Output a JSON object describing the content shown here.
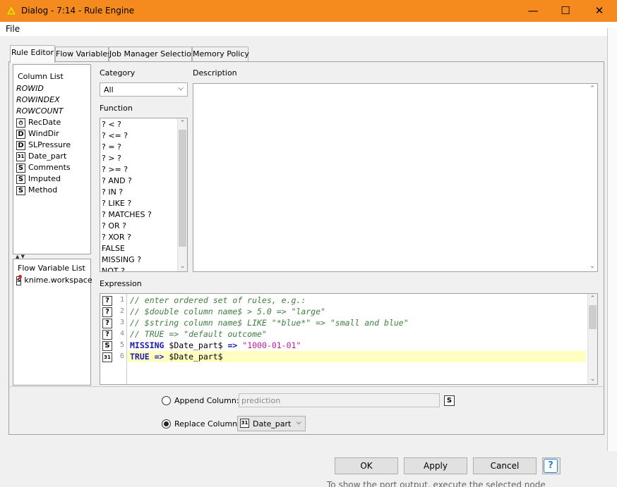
{
  "window": {
    "title": "Dialog - 7:14 - Rule Engine",
    "minimize": "—",
    "maximize": "☐",
    "close": "✕"
  },
  "menu": {
    "file": "File"
  },
  "tabs": [
    "Rule Editor",
    "Flow Variables",
    "Job Manager Selection",
    "Memory Policy"
  ],
  "column_list": {
    "title": "Column List",
    "items": [
      {
        "label": "ROWID",
        "type": "special"
      },
      {
        "label": "ROWINDEX",
        "type": "special"
      },
      {
        "label": "ROWCOUNT",
        "type": "special"
      },
      {
        "label": "RecDate",
        "type": "datetime",
        "icon": "⏱"
      },
      {
        "label": "WindDir",
        "type": "double",
        "icon": "D"
      },
      {
        "label": "SLPressure",
        "type": "double",
        "icon": "D"
      },
      {
        "label": "Date_part",
        "type": "date",
        "icon": "31"
      },
      {
        "label": "Comments",
        "type": "string",
        "icon": "S"
      },
      {
        "label": "Imputed",
        "type": "string",
        "icon": "S"
      },
      {
        "label": "Method",
        "type": "string",
        "icon": "S"
      }
    ]
  },
  "flow_variable_list": {
    "title": "Flow Variable List",
    "items": [
      {
        "label": "knime.workspace",
        "icon": "s"
      }
    ]
  },
  "category": {
    "label": "Category",
    "value": "All"
  },
  "function": {
    "label": "Function",
    "items": [
      "? < ?",
      "? <= ?",
      "? = ?",
      "? > ?",
      "? >= ?",
      "? AND ?",
      "? IN ?",
      "? LIKE ?",
      "? MATCHES ?",
      "? OR ?",
      "? XOR ?",
      "FALSE",
      "MISSING ?",
      "NOT ?"
    ]
  },
  "description": {
    "label": "Description"
  },
  "expression": {
    "label": "Expression",
    "lines": [
      {
        "num": "1",
        "icon": "?",
        "text": "// enter ordered set of rules, e.g.:"
      },
      {
        "num": "2",
        "icon": "?",
        "text": "// $double column name$ > 5.0 => \"large\""
      },
      {
        "num": "3",
        "icon": "?",
        "text": "// $string column name$ LIKE \"*blue*\" => \"small and blue\""
      },
      {
        "num": "4",
        "icon": "?",
        "text": "// TRUE => \"default outcome\""
      },
      {
        "num": "5",
        "icon": "S",
        "kw": "MISSING",
        "mid": " $Date_part$ ",
        "op": "=>",
        "str": "\"1000-01-01\""
      },
      {
        "num": "6",
        "icon": "31",
        "kw2": "TRUE",
        "op2": " => ",
        "rest": "$Date_part$"
      }
    ]
  },
  "append_column": {
    "label": "Append Column:",
    "placeholder": "prediction",
    "type_icon": "S"
  },
  "replace_column": {
    "label": "Replace Column:",
    "value": "Date_part"
  },
  "buttons": {
    "ok": "OK",
    "apply": "Apply",
    "cancel": "Cancel",
    "help": "?"
  },
  "background_text": "To show the port output, execute the selected node",
  "colors": {
    "titlebar": "#f58a1f",
    "comment": "#3f7f3f",
    "keyword": "#1a1ab8",
    "string": "#c01a9a",
    "highlight": "#ffffc0"
  }
}
